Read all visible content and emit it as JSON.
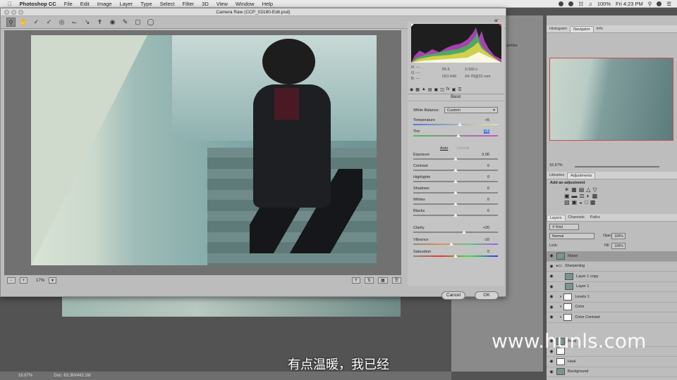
{
  "menubar": {
    "app": "Photoshop CC",
    "items": [
      "File",
      "Edit",
      "Image",
      "Layer",
      "Type",
      "Select",
      "Filter",
      "3D",
      "View",
      "Window",
      "Help"
    ],
    "battery": "100%",
    "clock": "Fri 4:23 PM"
  },
  "cr": {
    "title": "Camera Raw (CCP_03180-Edit.psd)",
    "zoom": "17%",
    "cancel": "Cancel",
    "ok": "OK",
    "rgb": {
      "r": "R:  ---",
      "g": "G:  ---",
      "b": "B:  ---",
      "aperture": "f/5.6",
      "shutter": "1/160 s",
      "iso": "ISO 640",
      "lens": "24-70@31 mm"
    },
    "panel_title": "Basic",
    "wb_label": "White Balance:",
    "wb_value": "Custom",
    "auto": "Auto",
    "default": "Default",
    "sliders": [
      {
        "name": "Temperature",
        "value": "+5",
        "pos": 0.55
      },
      {
        "name": "Tint",
        "value": "+5",
        "pos": 0.53
      },
      {
        "name": "Exposure",
        "value": "0.00",
        "pos": 0.5
      },
      {
        "name": "Contrast",
        "value": "0",
        "pos": 0.5
      },
      {
        "name": "Highlights",
        "value": "0",
        "pos": 0.5
      },
      {
        "name": "Shadows",
        "value": "0",
        "pos": 0.5
      },
      {
        "name": "Whites",
        "value": "0",
        "pos": 0.5
      },
      {
        "name": "Blacks",
        "value": "0",
        "pos": 0.5
      },
      {
        "name": "Clarity",
        "value": "+20",
        "pos": 0.6
      },
      {
        "name": "Vibrance",
        "value": "-10",
        "pos": 0.45
      },
      {
        "name": "Saturation",
        "value": "0",
        "pos": 0.5
      }
    ]
  },
  "ps": {
    "tabs1": [
      "Histogram",
      "Navigator",
      "Info"
    ],
    "nav_zoom": "16.67%",
    "tabs2": [
      "Libraries",
      "Adjustments"
    ],
    "add_adj": "Add an adjustment",
    "tabs3": [
      "Layers",
      "Channels",
      "Paths"
    ],
    "kind": "Kind",
    "blend": "Normal",
    "opacity_lbl": "Opacity:",
    "opacity": "100%",
    "lock": "Lock:",
    "fill_lbl": "Fill:",
    "fill": "100%",
    "layers": [
      "Noise",
      "Sharpening",
      "Layer 1 copy",
      "Layer 1",
      "Levels 1",
      "Color",
      "Color Contrast",
      "Base",
      "",
      "Heal",
      "Background"
    ],
    "status_zoom": "16.67%",
    "status_doc": "Doc: 63.3M/443.1M",
    "properties": "operties"
  },
  "subtitle": "有点温暖，我已经",
  "watermark": "www.hunls.com"
}
